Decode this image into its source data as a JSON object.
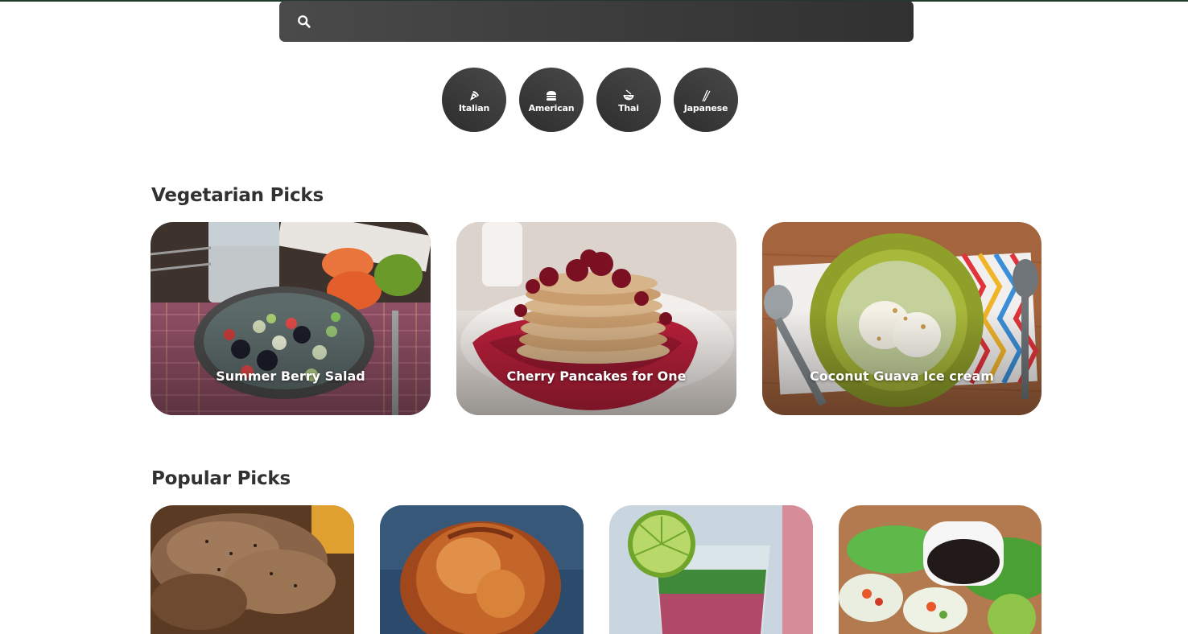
{
  "search": {
    "placeholder": "",
    "value": ""
  },
  "cuisines": [
    {
      "label": "Italian",
      "icon": "pizza-icon"
    },
    {
      "label": "American",
      "icon": "burger-icon"
    },
    {
      "label": "Thai",
      "icon": "noodle-bowl-icon"
    },
    {
      "label": "Japanese",
      "icon": "chopsticks-icon"
    }
  ],
  "vegetarian": {
    "title": "Vegetarian Picks",
    "items": [
      {
        "label": "Summer Berry Salad"
      },
      {
        "label": "Cherry Pancakes for One"
      },
      {
        "label": "Coconut Guava Ice cream"
      }
    ]
  },
  "popular": {
    "title": "Popular Picks"
  },
  "colors": {
    "accent": "#313131",
    "card_text": "#ffffff"
  }
}
